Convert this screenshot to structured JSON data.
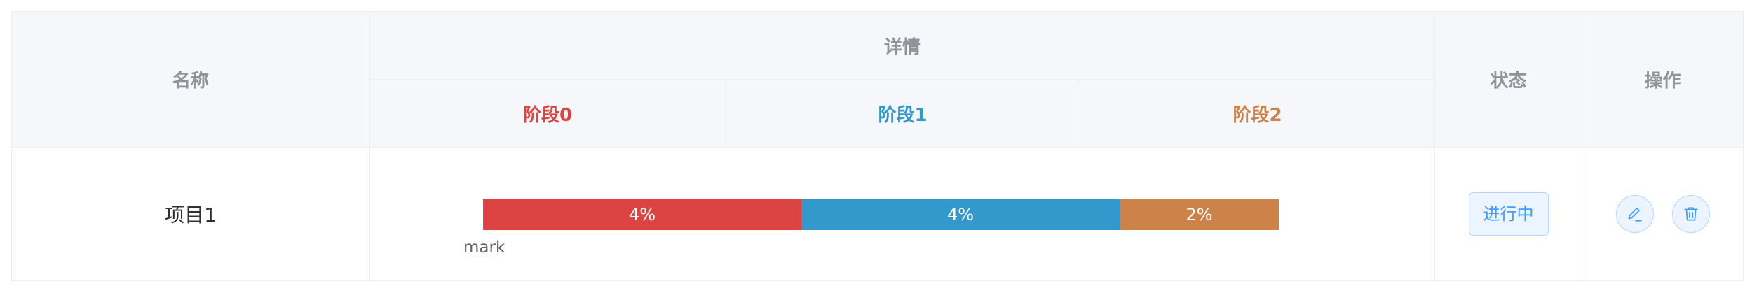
{
  "table": {
    "headers": {
      "name": "名称",
      "details": "详情",
      "status": "状态",
      "actions": "操作",
      "stages": [
        {
          "label": "阶段0",
          "color": "#dc4444"
        },
        {
          "label": "阶段1",
          "color": "#3399cc"
        },
        {
          "label": "阶段2",
          "color": "#cc8249"
        }
      ]
    },
    "rows": [
      {
        "name": "项目1",
        "progress": [
          {
            "label": "4%",
            "value": 4,
            "color": "#dc4444"
          },
          {
            "label": "4%",
            "value": 4,
            "color": "#3399cc"
          },
          {
            "label": "2%",
            "value": 2,
            "color": "#cc8249"
          }
        ],
        "mark": "mark",
        "status": "进行中",
        "actions": [
          {
            "icon": "edit-icon"
          },
          {
            "icon": "trash-icon"
          }
        ]
      }
    ]
  },
  "colors": {
    "header_bg": "#f5f7fa",
    "header_text": "#909399",
    "border": "#ebeef5",
    "primary": "#409eff"
  }
}
